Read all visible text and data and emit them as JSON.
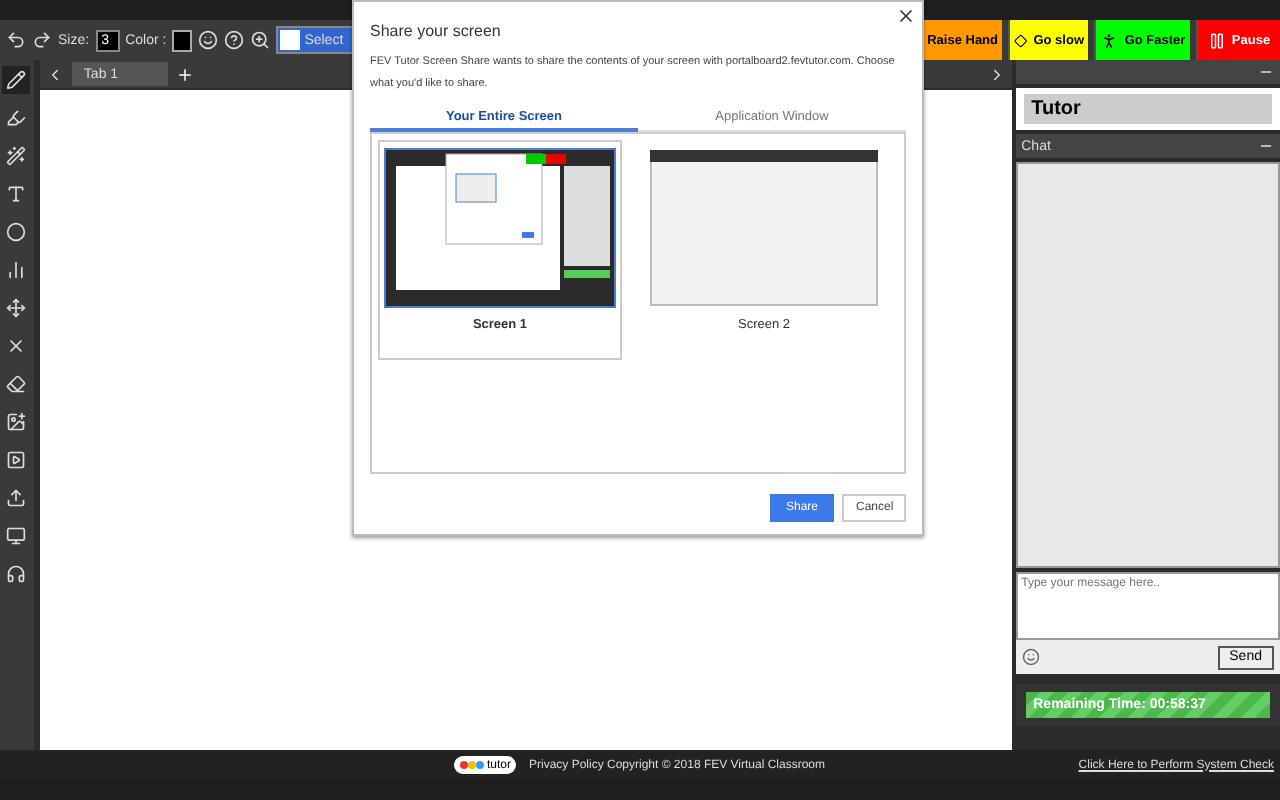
{
  "toolbar": {
    "size_label": "Size:",
    "size_value": "3",
    "color_label": "Color :",
    "translate_label": "Select"
  },
  "status_buttons": [
    {
      "kind": "raise",
      "label": "Raise Hand",
      "color": "#ff9900"
    },
    {
      "kind": "slow",
      "label": "Go slow",
      "color": "#ffff00"
    },
    {
      "kind": "faster",
      "label": "Go Faster",
      "color": "#00ff00"
    },
    {
      "kind": "pause",
      "label": "Pause",
      "color": "#ff0000"
    }
  ],
  "tabs": [
    {
      "label": "Tab 1",
      "selected": true
    }
  ],
  "tools": [
    {
      "kind": "pencil",
      "selected": true
    },
    {
      "kind": "highlighter",
      "selected": false
    },
    {
      "kind": "wand",
      "selected": false
    },
    {
      "kind": "text",
      "selected": false
    },
    {
      "kind": "circle",
      "selected": false
    },
    {
      "kind": "chart",
      "selected": false
    },
    {
      "kind": "move",
      "selected": false
    },
    {
      "kind": "clear",
      "selected": false
    },
    {
      "kind": "eraser",
      "selected": false
    },
    {
      "kind": "image",
      "selected": false
    },
    {
      "kind": "video",
      "selected": false
    },
    {
      "kind": "upload",
      "selected": false
    },
    {
      "kind": "screen",
      "selected": false
    },
    {
      "kind": "audio",
      "selected": false
    }
  ],
  "sidebar": {
    "tutor_name": "Tutor",
    "chat_title": "Chat",
    "message_placeholder": "Type your message here..",
    "send": "Send",
    "remaining": {
      "text": "Remaining Time: 00:58:37",
      "level": 1
    }
  },
  "footer": {
    "logo_text": "tutor",
    "copyright": "Privacy Policy Copyright © 2018 FEV Virtual Classroom",
    "system_check": "Click Here to Perform System Check"
  },
  "dialog": {
    "title": "Share your screen",
    "description": "FEV Tutor Screen Share wants to share the contents of your screen with portalboard2.fevtutor.com. Choose what you'd like to share.",
    "tabs": [
      {
        "label": "Your Entire Screen",
        "selected": true
      },
      {
        "label": "Application Window",
        "selected": false
      }
    ],
    "sources": [
      {
        "kind": "desktop",
        "label": "Screen 1",
        "selected": true
      },
      {
        "kind": "blank",
        "label": "Screen 2",
        "selected": false
      }
    ],
    "buttons": [
      {
        "kind": "primary",
        "label": "Share"
      },
      {
        "kind": "secondary",
        "label": "Cancel"
      }
    ]
  }
}
